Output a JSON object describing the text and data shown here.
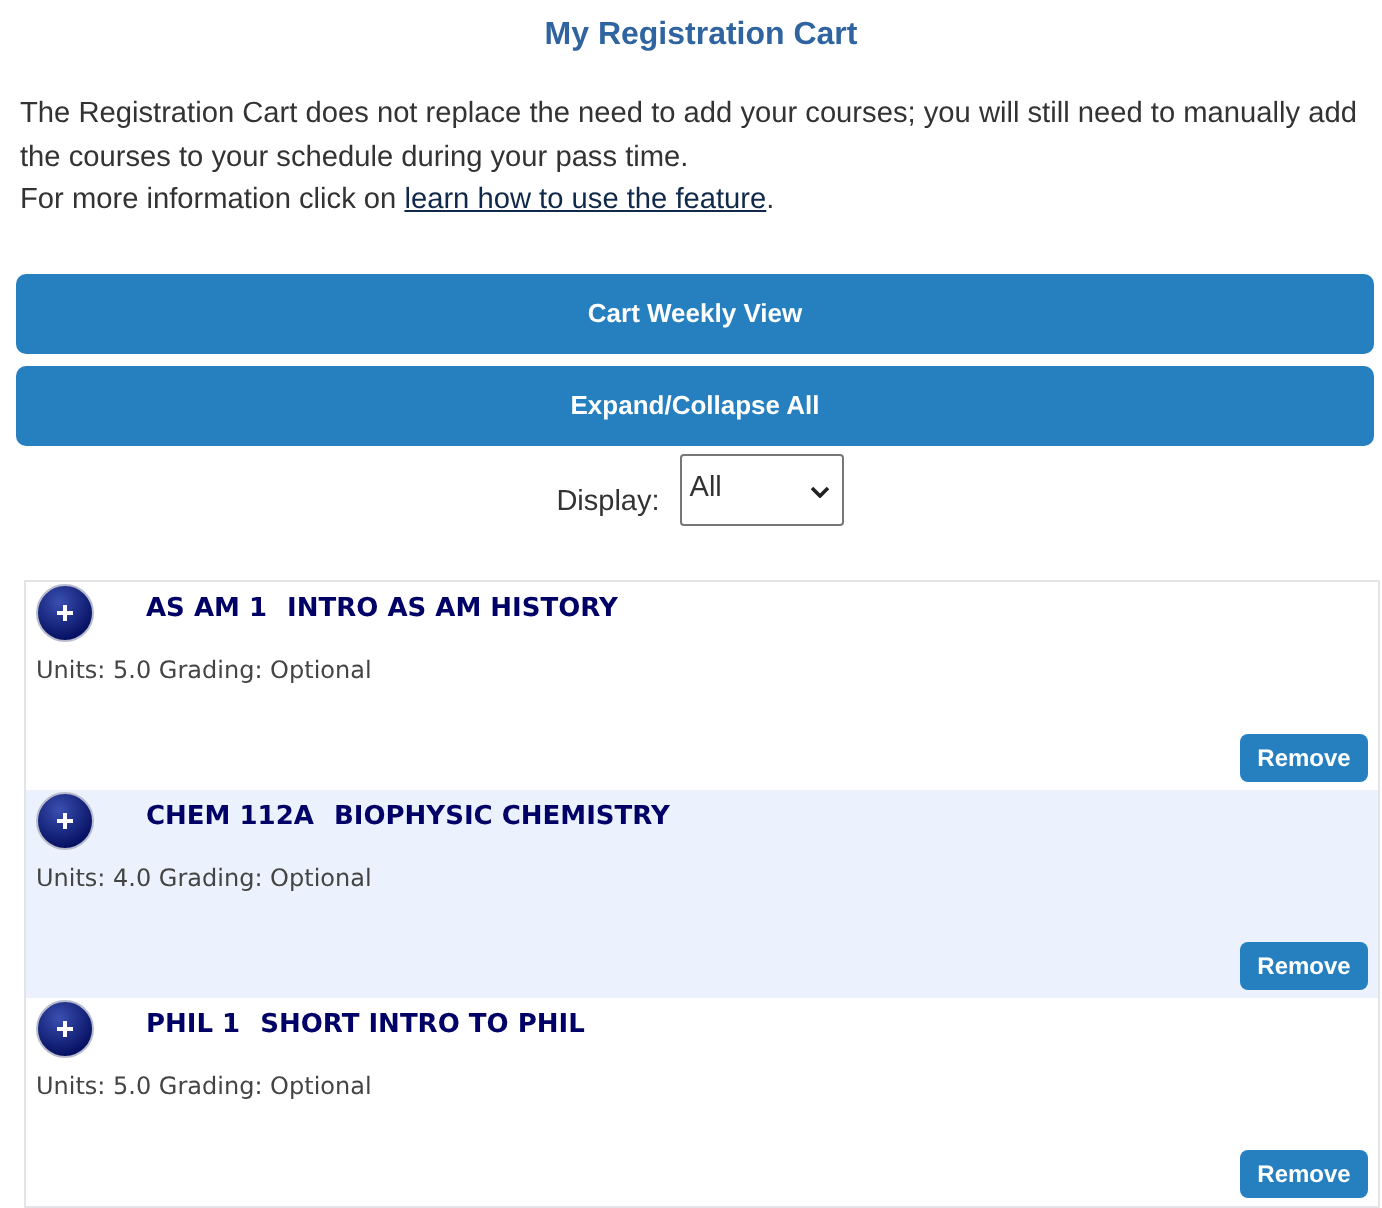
{
  "title": "My Registration Cart",
  "notice": {
    "text": "The Registration Cart does not replace the need to add your courses; you will still need to manually add the courses to your schedule during your pass time.",
    "more": {
      "text": "For more information click on ",
      "link": "learn how to use the feature",
      "after": "."
    }
  },
  "buttons": [
    "Cart Weekly View",
    "Expand/Collapse All"
  ],
  "display": {
    "label": "Display:",
    "value": "All"
  },
  "courses": [
    {
      "code": "AS AM 1",
      "title": "INTRO AS AM HISTORY",
      "details": "Units: 5.0 Grading: Optional",
      "expanded": false,
      "action": "Remove"
    },
    {
      "code": "CHEM 112A",
      "title": "BIOPHYSIC CHEMISTRY",
      "details": "Units: 4.0 Grading: Optional",
      "expanded": false,
      "action": "Remove"
    },
    {
      "code": "PHIL 1",
      "title": "SHORT INTRO TO PHIL",
      "details": "Units: 5.0 Grading: Optional",
      "expanded": false,
      "action": "Remove"
    }
  ]
}
